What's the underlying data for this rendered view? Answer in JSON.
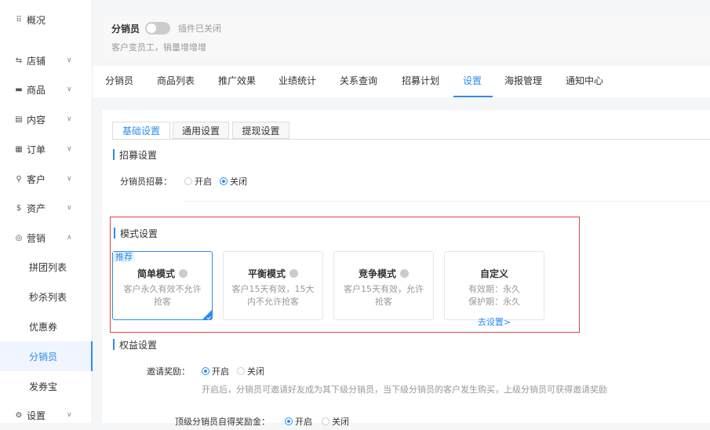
{
  "sidebar": {
    "items": [
      {
        "icon": "grid-icon",
        "glyph": "⠿",
        "label": "概况",
        "chevron": ""
      },
      {
        "icon": "store-icon",
        "glyph": "⇆",
        "label": "店铺",
        "chevron": "∨"
      },
      {
        "icon": "product-icon",
        "glyph": "▬",
        "label": "商品",
        "chevron": "∨"
      },
      {
        "icon": "content-icon",
        "glyph": "▤",
        "label": "内容",
        "chevron": "∨"
      },
      {
        "icon": "order-icon",
        "glyph": "▦",
        "label": "订单",
        "chevron": "∨"
      },
      {
        "icon": "customer-icon",
        "glyph": "⚲",
        "label": "客户",
        "chevron": "∨"
      },
      {
        "icon": "asset-icon",
        "glyph": "$",
        "label": "资产",
        "chevron": "∨"
      },
      {
        "icon": "marketing-icon",
        "glyph": "◎",
        "label": "营销",
        "chevron": "∧"
      }
    ],
    "sub_items": [
      {
        "label": "拼团列表"
      },
      {
        "label": "秒杀列表"
      },
      {
        "label": "优惠券"
      },
      {
        "label": "分销员"
      },
      {
        "label": "发券宝"
      }
    ],
    "bottom_item": {
      "icon": "settings-icon",
      "glyph": "⚙",
      "label": "设置",
      "chevron": "∨"
    }
  },
  "header": {
    "title": "分销员",
    "status": "插件已关闭",
    "description": "客户变员工，销量增增增"
  },
  "tabs": [
    "分销员",
    "商品列表",
    "推广效果",
    "业绩统计",
    "关系查询",
    "招募计划",
    "设置",
    "海报管理",
    "通知中心"
  ],
  "active_tab": "设置",
  "subtabs": [
    "基础设置",
    "通用设置",
    "提现设置"
  ],
  "recruit": {
    "section_title": "招募设置",
    "label": "分销员招募：",
    "options": [
      "开启",
      "关闭"
    ],
    "selected": "关闭"
  },
  "mode": {
    "section_title": "模式设置",
    "cards": [
      {
        "title": "简单模式",
        "desc": "客户永久有效不允许抢客",
        "badge": "推荐",
        "selected": true
      },
      {
        "title": "平衡模式",
        "desc": "客户15天有效，15大内不允许抢客"
      },
      {
        "title": "竞争模式",
        "desc": "客户15天有效，允许抢客"
      },
      {
        "title": "自定义",
        "line1": "有效期：永久",
        "line2": "保护期：永久",
        "link": "去设置>"
      }
    ]
  },
  "rights": {
    "section_title": "权益设置",
    "invite_label": "邀请奖励：",
    "invite_options": [
      "开启",
      "关闭"
    ],
    "invite_selected": "开启",
    "invite_hint": "开启后，分销员可邀请好友成为其下级分销员，当下级分销员的客户发生购买，上级分销员可获得邀请奖励",
    "top_label": "顶级分销员自得奖励金：",
    "top_options": [
      "开启",
      "关闭"
    ],
    "top_selected": "开启"
  },
  "colors": {
    "accent": "#2d8cf0",
    "highlight_border": "#e04444"
  }
}
